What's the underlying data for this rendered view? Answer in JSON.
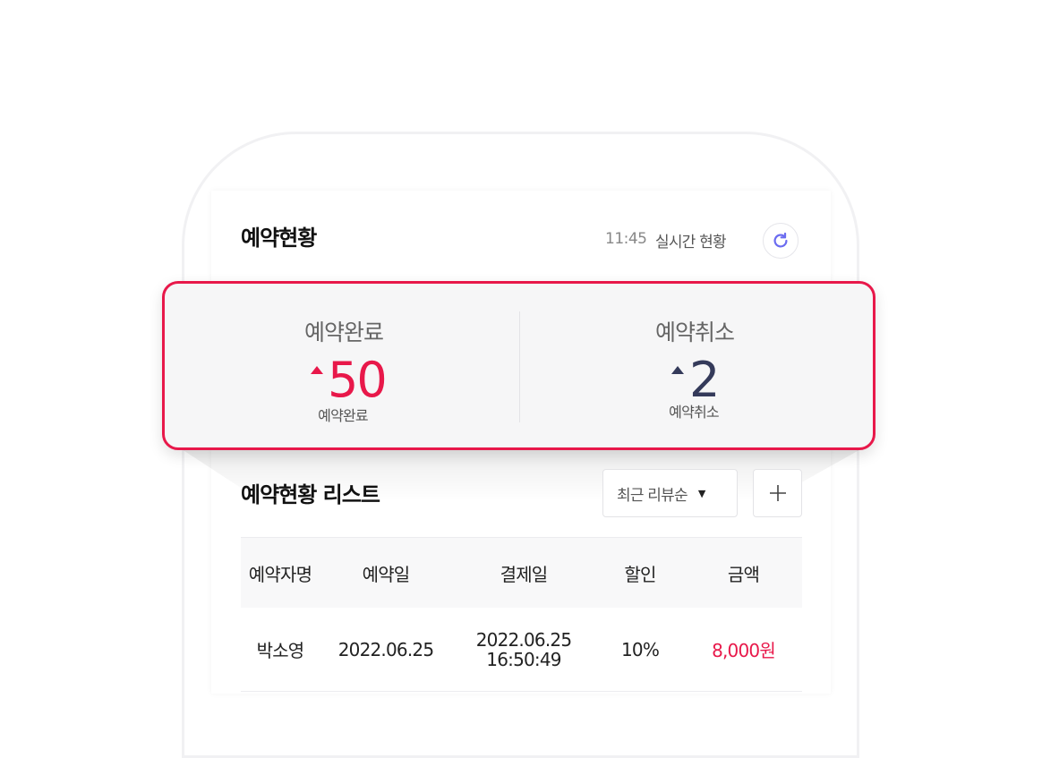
{
  "header": {
    "title": "예약현황",
    "time": "11:45",
    "realtime_label": "실시간 현황",
    "refresh_icon": "refresh-icon"
  },
  "stats": {
    "completed": {
      "title": "예약완료",
      "value": "50",
      "sub_label": "예약완료",
      "color": "#e8184a"
    },
    "cancelled": {
      "title": "예약취소",
      "value": "2",
      "sub_label": "예약취소",
      "color": "#343a5a"
    }
  },
  "list": {
    "title": "예약현황 리스트",
    "sort": {
      "selected": "최근 리뷰순"
    },
    "add_icon": "plus-icon",
    "columns": [
      "예약자명",
      "예약일",
      "결제일",
      "할인",
      "금액"
    ],
    "rows": [
      {
        "name": "박소영",
        "reservation_date": "2022.06.25",
        "payment_date": "2022.06.25",
        "payment_time": "16:50:49",
        "discount": "10%",
        "amount": "8,000원"
      }
    ]
  },
  "colors": {
    "accent": "#e8184a",
    "refresh": "#6b6cf0",
    "secondary_number": "#343a5a"
  }
}
